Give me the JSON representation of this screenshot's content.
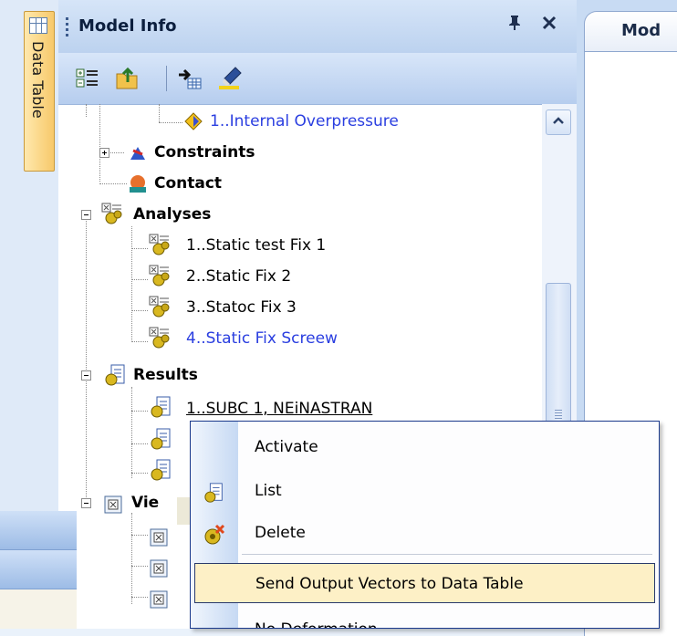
{
  "data_table_tab": {
    "label": "Data Table"
  },
  "panel": {
    "title": "Model Info",
    "pin_glyph": "ᵖ",
    "close_glyph": "✕"
  },
  "doc_tab": {
    "label": "Mod"
  },
  "tree": {
    "load_item": "1..Internal Overpressure",
    "constraints": "Constraints",
    "contact": "Contact",
    "analyses": "Analyses",
    "analyses_items": [
      "1..Static test Fix 1",
      "2..Static Fix 2",
      "3..Statoc Fix 3",
      "4..Static Fix Screew"
    ],
    "results": "Results",
    "result_item_1": "1..SUBC 1, NEiNASTRAN",
    "views_partial": "Vie",
    "partial_last": "N"
  },
  "context_menu": {
    "items": [
      "Activate",
      "List",
      "Delete",
      "Send Output Vectors to Data Table",
      "No Deformation"
    ]
  },
  "colors": {
    "blue_text": "#2a3ee0",
    "menu_highlight": "#fdf0c6",
    "menu_border": "#1b3a8c"
  }
}
